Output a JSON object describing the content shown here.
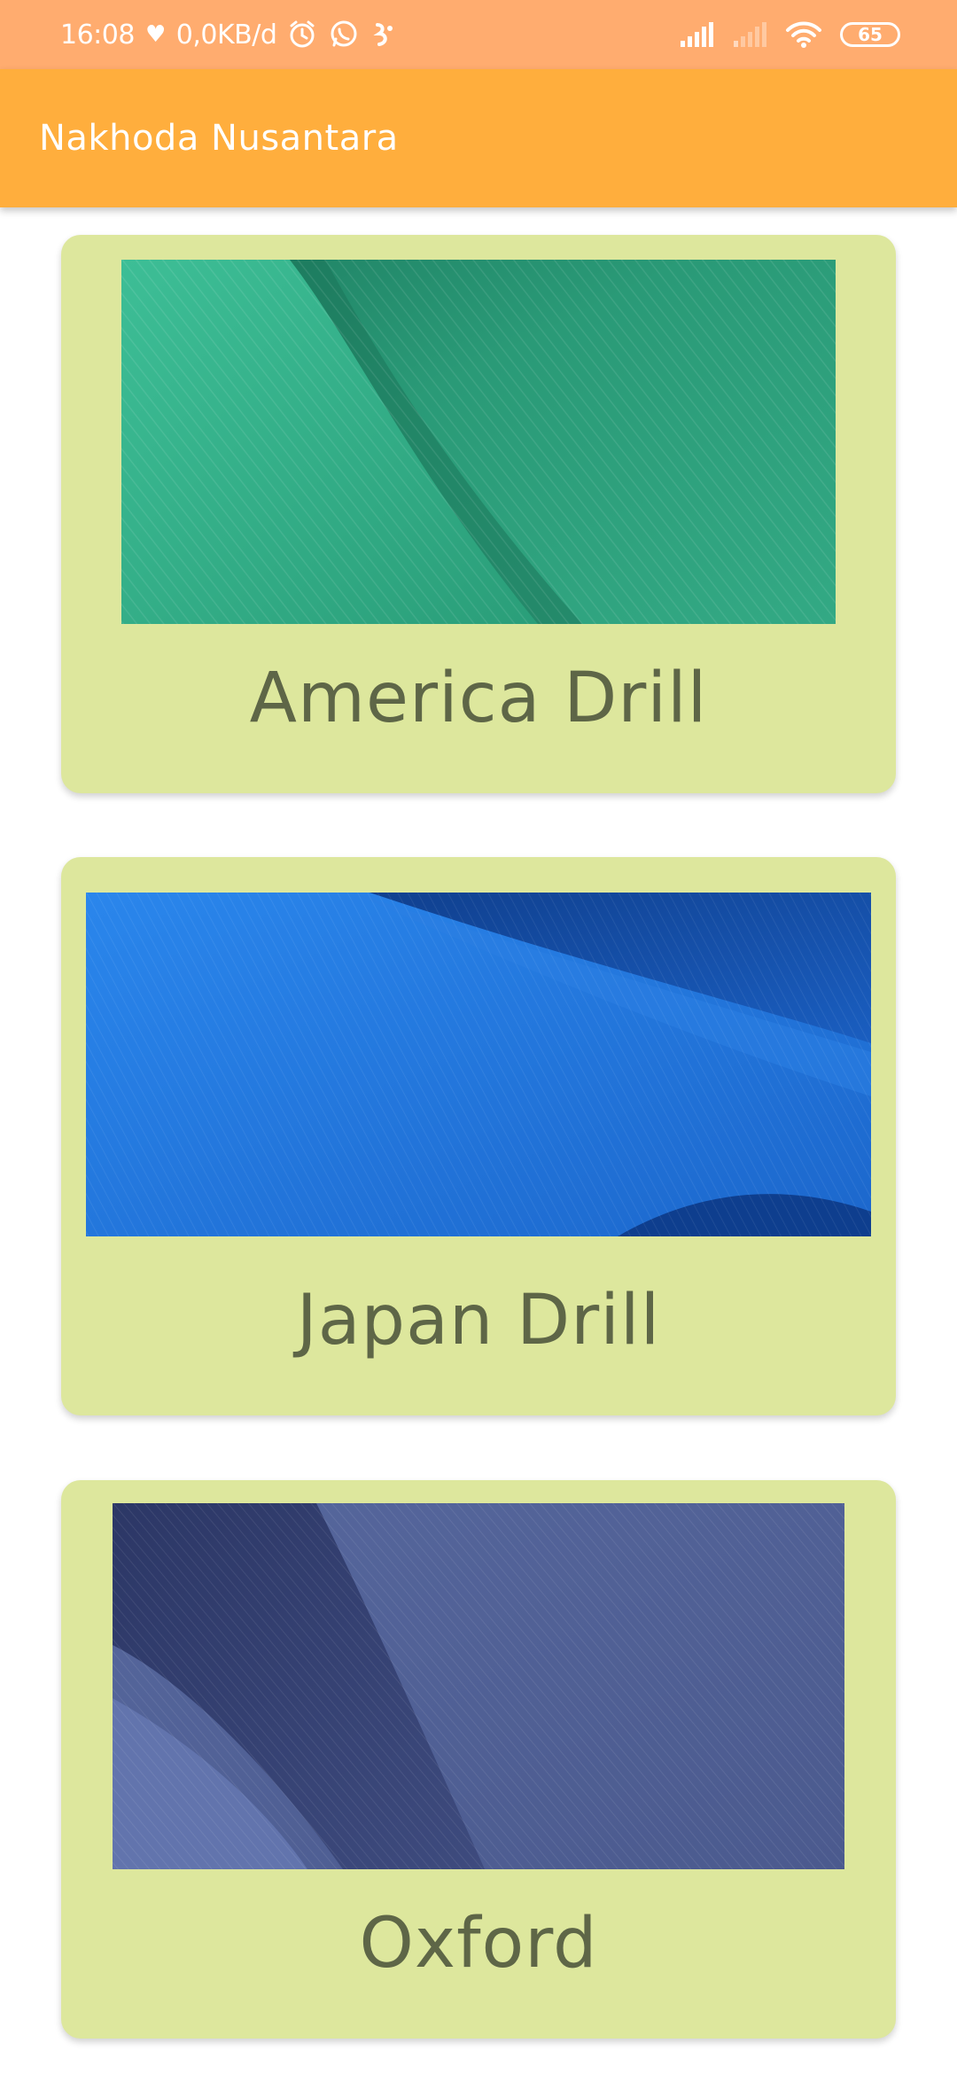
{
  "status_bar": {
    "time": "16:08",
    "heart": "♥",
    "network_speed": "0,0KB/d",
    "battery": "65",
    "icons": [
      "alarm-icon",
      "whatsapp-icon",
      "app-icon",
      "signal-icon",
      "signal-weak-icon",
      "wifi-icon",
      "battery-icon"
    ]
  },
  "app_bar": {
    "title": "Nakhoda Nusantara"
  },
  "cards": [
    {
      "title": "America Drill",
      "image": "green-fabric-image",
      "color": "#2FA884"
    },
    {
      "title": "Japan Drill",
      "image": "blue-fabric-image",
      "color": "#1B6ED8"
    },
    {
      "title": "Oxford",
      "image": "navy-fabric-image",
      "color": "#4F5F95"
    }
  ],
  "colors": {
    "status_bar": "#FFAC6F",
    "app_bar": "#FFAE3D",
    "card_background": "#DDE79D",
    "card_text": "#5E6647"
  }
}
